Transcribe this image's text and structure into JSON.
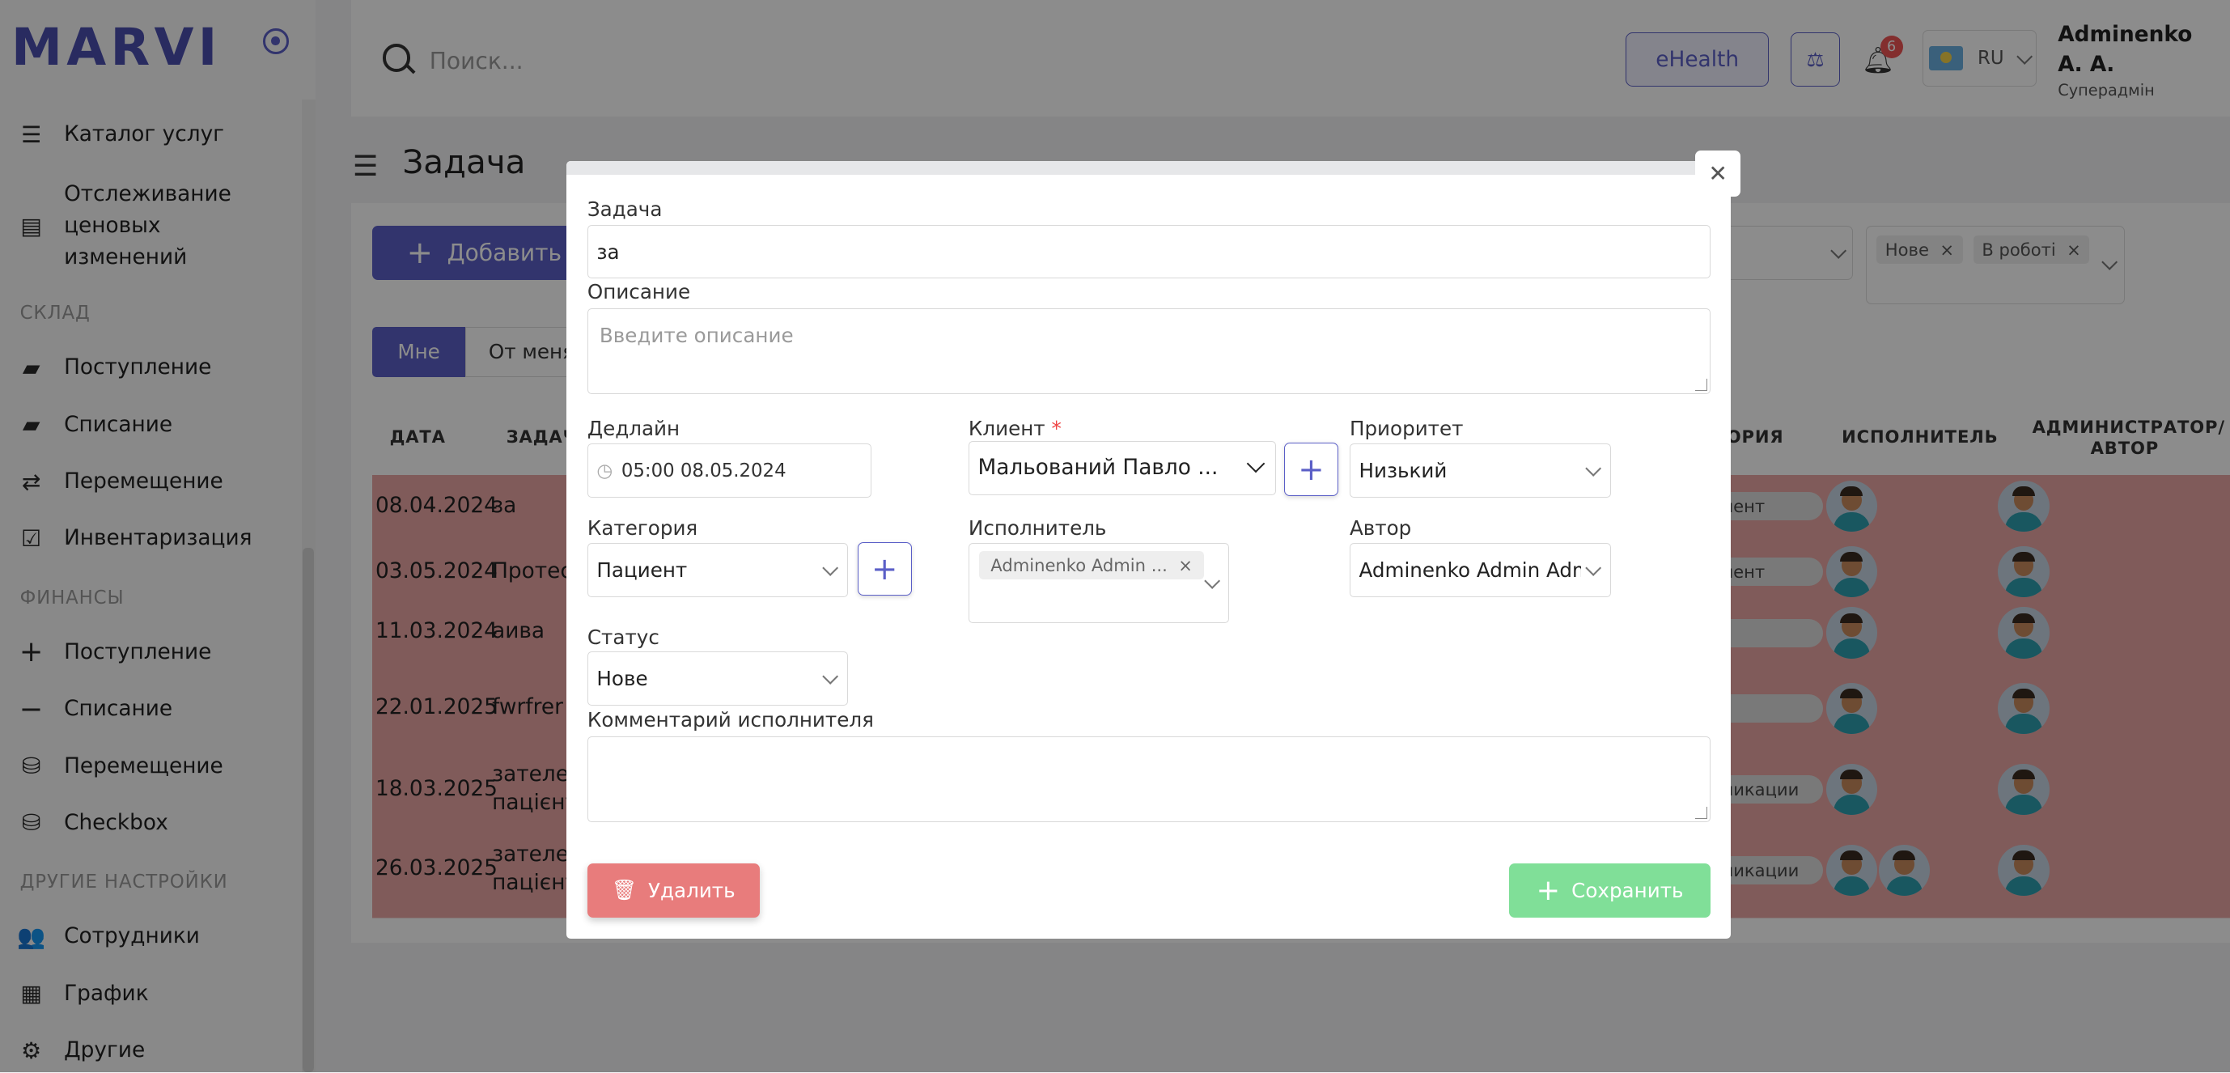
{
  "sidebar": {
    "logo": "MARVI",
    "items": [
      {
        "label": "Каталог услуг",
        "icon": "list-icon"
      },
      {
        "label": "Отслеживание ценовых изменений",
        "icon": "price-tracking-icon"
      },
      {
        "label": "Поступление",
        "icon": "folder-plus-icon"
      },
      {
        "label": "Списание",
        "icon": "folder-minus-icon"
      },
      {
        "label": "Перемещение",
        "icon": "transfer-arrows-icon"
      },
      {
        "label": "Инвентаризация",
        "icon": "inventory-check-icon"
      },
      {
        "label": "Поступление",
        "icon": "plus-icon"
      },
      {
        "label": "Списание",
        "icon": "minus-icon"
      },
      {
        "label": "Перемещение",
        "icon": "money-transfer-icon"
      },
      {
        "label": "Checkbox",
        "icon": "checkbox-register-icon"
      },
      {
        "label": "Сотрудники",
        "icon": "employees-icon"
      },
      {
        "label": "График",
        "icon": "schedule-icon"
      },
      {
        "label": "Другие",
        "icon": "other-settings-icon"
      }
    ],
    "sections": {
      "warehouse": "СКЛАД",
      "finance": "ФИНАНСЫ",
      "other": "ДРУГИЕ НАСТРОЙКИ"
    }
  },
  "header": {
    "search_placeholder": "Поиск...",
    "ehealth_label": "eHealth",
    "notifications_count": "6",
    "language": "RU",
    "user_name": "Adminenko А. А.",
    "user_role": "Суперадмін"
  },
  "page": {
    "title": "Задача",
    "add_button": "Добавить",
    "tabs": [
      "Мне",
      "От меня"
    ],
    "status_filter_tags": [
      "Нове",
      "В роботі"
    ]
  },
  "table": {
    "headers": {
      "date": "ДАТА",
      "task": "ЗАДАЧА",
      "category": "ОРИЯ",
      "executor": "ИСПОЛНИТЕЛЬ",
      "admin_author": "АДМИНИСТРАТОР/ АВТОР"
    },
    "rows": [
      {
        "date": "08.04.2024",
        "task": "за",
        "category": "иент"
      },
      {
        "date": "03.05.2024",
        "task": "Протес",
        "category": "иент"
      },
      {
        "date": "11.03.2024",
        "task": "аива",
        "category": "-"
      },
      {
        "date": "22.01.2025",
        "task": "fwrfrer",
        "category": "-"
      },
      {
        "date": "18.03.2025",
        "task": "зателес пацієнт",
        "category": "никации"
      },
      {
        "date": "26.03.2025",
        "task": "зателес пацієнт",
        "category": "никации"
      }
    ]
  },
  "modal": {
    "task_label": "Задача",
    "task_value": "за",
    "description_label": "Описание",
    "description_placeholder": "Введите описание",
    "deadline_label": "Дедлайн",
    "deadline_value": "05:00 08.05.2024",
    "client_label": "Клиент",
    "client_value": "Мальований Павло ...",
    "priority_label": "Приоритет",
    "priority_value": "Низький",
    "category_label": "Категория",
    "category_value": "Пациент",
    "executor_label": "Исполнитель",
    "executor_tag": "Adminenko Admin ...",
    "author_label": "Автор",
    "author_value": "Adminenko Admin Adm",
    "status_label": "Статус",
    "status_value": "Нове",
    "comment_label": "Комментарий исполнителя",
    "delete_button": "Удалить",
    "save_button": "Сохранить"
  },
  "colors": {
    "accent": "#5b5fc7",
    "overdue_row": "#e9a7a4",
    "save": "#80df98",
    "delete": "#e87c7c"
  }
}
